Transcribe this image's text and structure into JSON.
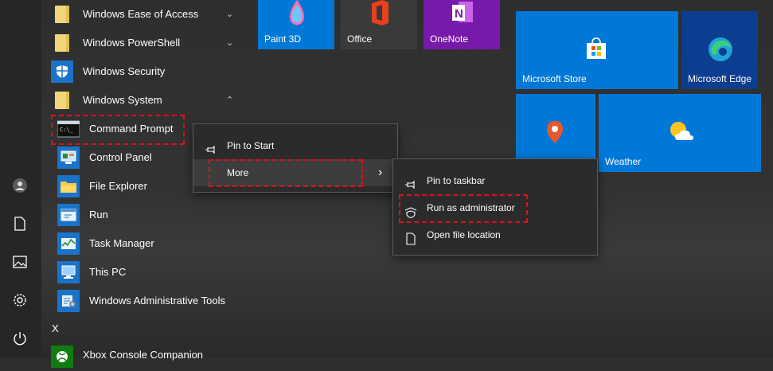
{
  "app_list": {
    "items": [
      {
        "label": "Windows Ease of Access",
        "chevron": "⌄"
      },
      {
        "label": "Windows PowerShell",
        "chevron": "⌄"
      },
      {
        "label": "Windows Security"
      },
      {
        "label": "Windows System",
        "chevron": "⌃"
      },
      {
        "label": "Command Prompt"
      },
      {
        "label": "Control Panel"
      },
      {
        "label": "File Explorer"
      },
      {
        "label": "Run"
      },
      {
        "label": "Task Manager"
      },
      {
        "label": "This PC"
      },
      {
        "label": "Windows Administrative Tools"
      }
    ],
    "group_letter": "X",
    "next_item": "Xbox Console Companion"
  },
  "tiles": {
    "paint3d": "Paint 3D",
    "office": "Office",
    "onenote": "OneNote",
    "store": "Microsoft Store",
    "edge": "Microsoft Edge",
    "weather": "Weather"
  },
  "context_menu": {
    "pin_start": "Pin to Start",
    "more": "More",
    "submenu_arrow": "›"
  },
  "submenu": {
    "pin_taskbar": "Pin to taskbar",
    "run_admin": "Run as administrator",
    "open_location": "Open file location"
  },
  "colors": {
    "tile_blue": "#0078d7",
    "onenote_purple": "#7719aa",
    "highlight": "#d9121a"
  }
}
